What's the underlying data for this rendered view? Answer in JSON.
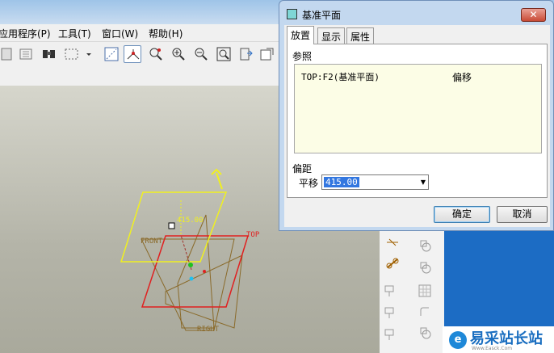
{
  "menubar": {
    "items": [
      "应用程序(P)",
      "工具(T)",
      "窗口(W)",
      "帮助(H)"
    ]
  },
  "toolbar": {
    "icons": [
      "regenerate-icon",
      "datum-display-icon",
      "binoculars-icon",
      "select-box-icon",
      "sketch-display-icon",
      "datum-axis-icon",
      "spin-center-icon",
      "zoom-in-icon",
      "zoom-out-icon",
      "refit-icon",
      "save-view-icon",
      "orient-icon"
    ]
  },
  "graphics": {
    "labels": {
      "dimension": "415.00",
      "front": "FRONT",
      "top": "TOP",
      "right": "RIGHT"
    },
    "colors": {
      "new_plane": "#f0f020",
      "top_plane": "#e02020",
      "other_planes": "#8a6a2a"
    }
  },
  "dialog": {
    "title": "基准平面",
    "close": "✕",
    "tabs": [
      "放置",
      "显示",
      "属性"
    ],
    "references_label": "参照",
    "reference": {
      "name": "TOP:F2(基准平面)",
      "type": "偏移"
    },
    "offset_label": "偏距",
    "translation_label": "平移",
    "translation_value": "415.00",
    "ok": "确定",
    "cancel": "取消"
  },
  "watermark": {
    "logo": "e",
    "text": "易采站长站",
    "sub": "Www.Easck.Com"
  }
}
